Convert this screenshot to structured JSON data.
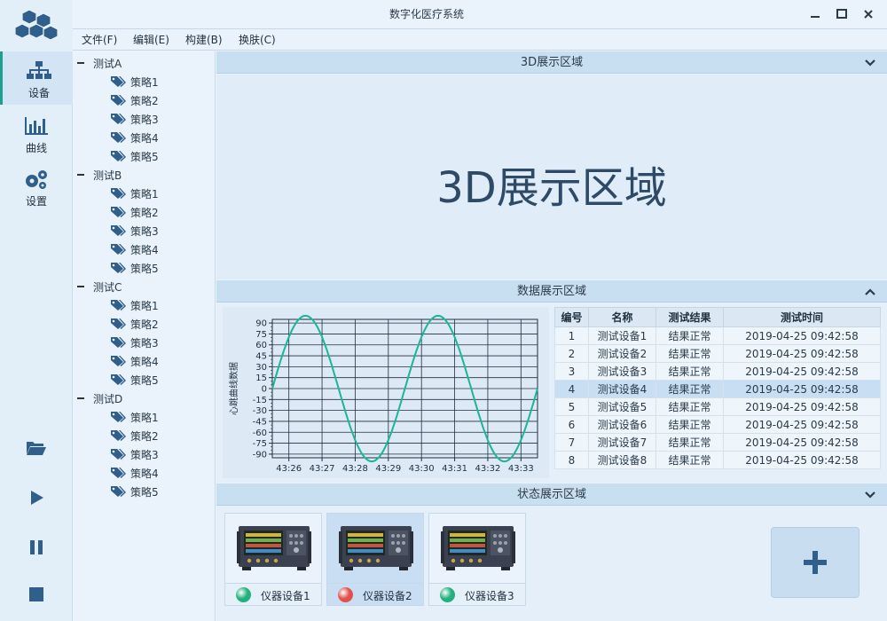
{
  "app": {
    "title": "数字化医疗系统"
  },
  "menu": [
    "文件(F)",
    "编辑(E)",
    "构建(B)",
    "换肤(C)"
  ],
  "nav": [
    {
      "label": "设备",
      "icon": "sitemap-icon",
      "active": true
    },
    {
      "label": "曲线",
      "icon": "bar-chart-icon",
      "active": false
    },
    {
      "label": "设置",
      "icon": "gears-icon",
      "active": false
    }
  ],
  "controls": [
    "folder-open-icon",
    "play-icon",
    "pause-icon",
    "stop-icon"
  ],
  "tree": [
    {
      "name": "测试A",
      "children": [
        "策略1",
        "策略2",
        "策略3",
        "策略4",
        "策略5"
      ]
    },
    {
      "name": "测试B",
      "children": [
        "策略1",
        "策略2",
        "策略3",
        "策略4",
        "策略5"
      ]
    },
    {
      "name": "测试C",
      "children": [
        "策略1",
        "策略2",
        "策略3",
        "策略4",
        "策略5"
      ]
    },
    {
      "name": "测试D",
      "children": [
        "策略1",
        "策略2",
        "策略3",
        "策略4",
        "策略5"
      ]
    }
  ],
  "sections": {
    "s3d": {
      "title": "3D展示区域",
      "body": "3D展示区域",
      "chevron": "down"
    },
    "data": {
      "title": "数据展示区域",
      "chevron": "up"
    },
    "status": {
      "title": "状态展示区域",
      "chevron": "down"
    }
  },
  "chart_data": {
    "type": "line",
    "ylabel": "心跳曲线数据",
    "ylim": [
      -95,
      95
    ],
    "y_ticks": [
      90,
      75,
      60,
      45,
      30,
      15,
      0,
      -15,
      -30,
      -45,
      -60,
      -75,
      -90
    ],
    "x_ticks": [
      "43:26",
      "43:27",
      "43:28",
      "43:29",
      "43:30",
      "43:31",
      "43:32",
      "43:33"
    ],
    "series": [
      {
        "color": "#1bb598",
        "x": [
          0,
          0.5,
          1,
          1.5,
          2,
          2.5,
          3,
          3.5,
          4,
          4.5,
          5,
          5.5,
          6,
          6.5,
          7,
          7.5,
          8
        ],
        "y": [
          0,
          70,
          100,
          70,
          0,
          -70,
          -100,
          -70,
          0,
          70,
          100,
          70,
          0,
          -70,
          -100,
          -70,
          0
        ]
      }
    ]
  },
  "table": {
    "headers": [
      "编号",
      "名称",
      "测试结果",
      "测试时间"
    ],
    "rows": [
      [
        "1",
        "测试设备1",
        "结果正常",
        "2019-04-25 09:42:58"
      ],
      [
        "2",
        "测试设备2",
        "结果正常",
        "2019-04-25 09:42:58"
      ],
      [
        "3",
        "测试设备3",
        "结果正常",
        "2019-04-25 09:42:58"
      ],
      [
        "4",
        "测试设备4",
        "结果正常",
        "2019-04-25 09:42:58"
      ],
      [
        "5",
        "测试设备5",
        "结果正常",
        "2019-04-25 09:42:58"
      ],
      [
        "6",
        "测试设备6",
        "结果正常",
        "2019-04-25 09:42:58"
      ],
      [
        "7",
        "测试设备7",
        "结果正常",
        "2019-04-25 09:42:58"
      ],
      [
        "8",
        "测试设备8",
        "结果正常",
        "2019-04-25 09:42:58"
      ]
    ],
    "selected_row": 3
  },
  "devices": [
    {
      "label": "仪器设备1",
      "status_color": "#22b07d",
      "selected": false
    },
    {
      "label": "仪器设备2",
      "status_color": "#e2504c",
      "selected": true
    },
    {
      "label": "仪器设备3",
      "status_color": "#22b07d",
      "selected": false
    }
  ],
  "add_button": {
    "icon": "plus-icon"
  },
  "colors": {
    "accent": "#1e9e8c",
    "header": "#c8dff1"
  }
}
